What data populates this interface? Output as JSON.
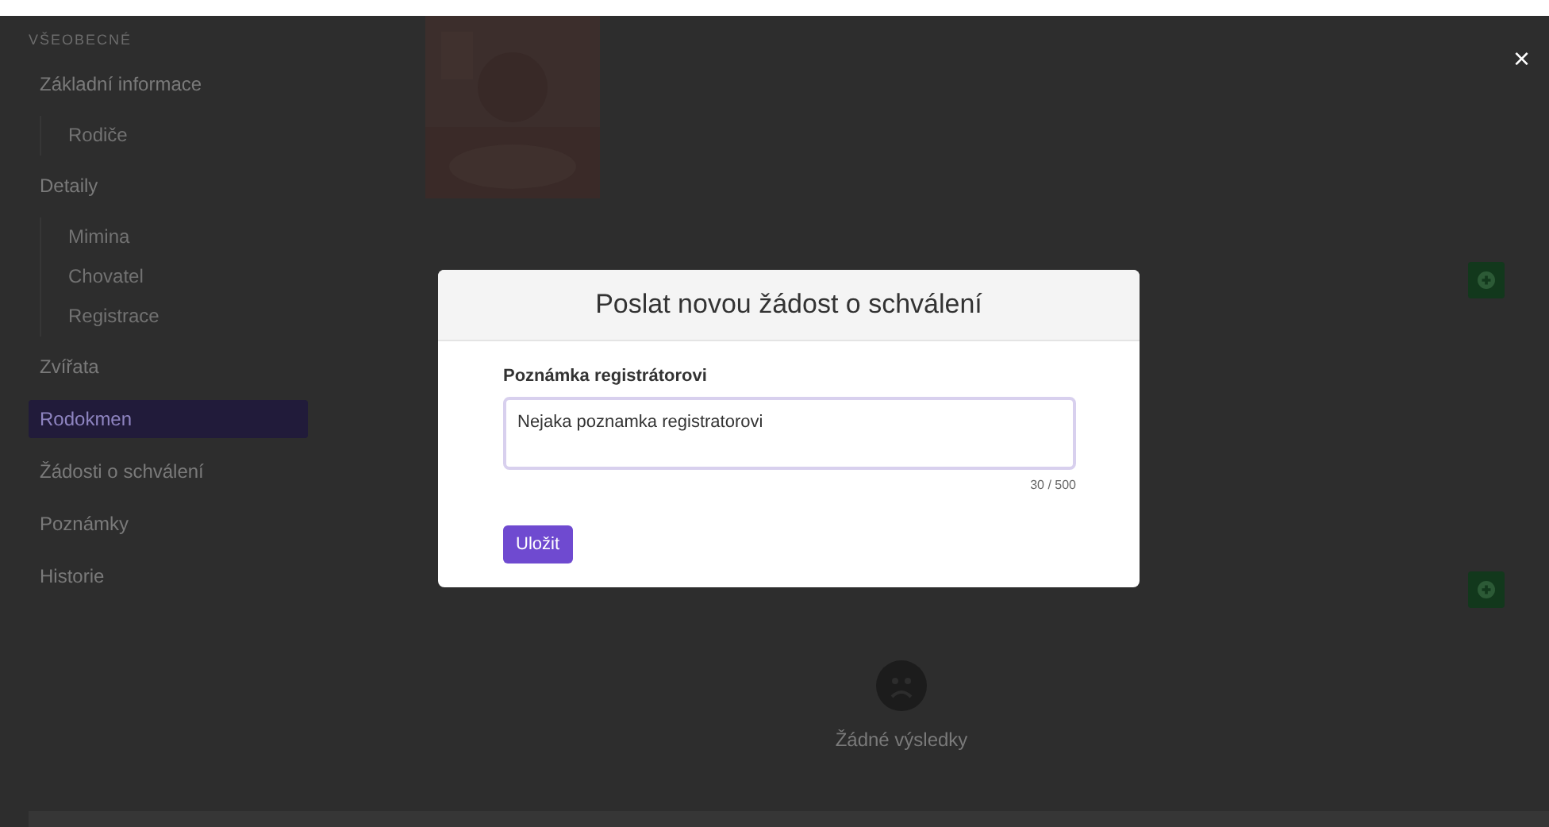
{
  "sidebar": {
    "section": "VŠEOBECNÉ",
    "items": [
      {
        "label": "Základní informace",
        "selected": false,
        "children": [
          {
            "label": "Rodiče",
            "selected": false
          }
        ]
      },
      {
        "label": "Detaily",
        "selected": false,
        "children": [
          {
            "label": "Mimina",
            "selected": false
          },
          {
            "label": "Chovatel",
            "selected": false
          },
          {
            "label": "Registrace",
            "selected": false
          }
        ]
      },
      {
        "label": "Zvířata",
        "selected": false
      },
      {
        "label": "Rodokmen",
        "selected": true
      },
      {
        "label": "Žádosti o schválení",
        "selected": false
      },
      {
        "label": "Poznámky",
        "selected": false
      },
      {
        "label": "Historie",
        "selected": false
      }
    ]
  },
  "content": {
    "sections": [
      {
        "kind": "list"
      },
      {
        "kind": "empty",
        "empty_text": "Žádné výsledky"
      }
    ]
  },
  "close_button": "×",
  "modal": {
    "title": "Poslat novou žádost o schválení",
    "field_label": "Poznámka registrátorovi",
    "value": "Nejaka poznamka registratorovi",
    "counter": "30 / 500",
    "submit": "Uložit"
  }
}
